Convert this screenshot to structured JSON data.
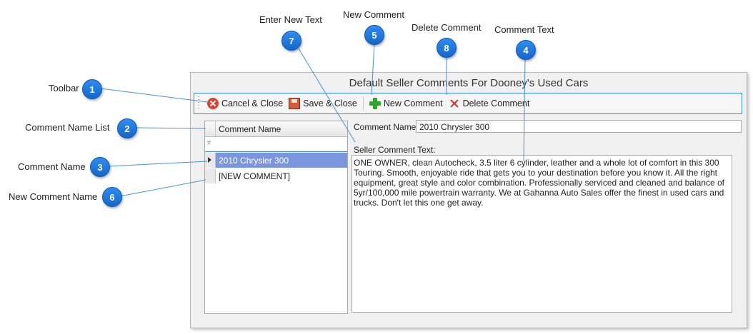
{
  "window": {
    "title": "Default Seller Comments For Dooney's Used Cars"
  },
  "toolbar": {
    "cancel_label": "Cancel & Close",
    "save_label": "Save & Close",
    "new_label": "New Comment",
    "delete_label": "Delete Comment"
  },
  "list": {
    "header": "Comment Name",
    "items": [
      {
        "label": "2010 Chrysler 300",
        "selected": true
      },
      {
        "label": "[NEW COMMENT]",
        "selected": false
      }
    ]
  },
  "form": {
    "name_label": "Comment Name:",
    "name_value": "2010 Chrysler 300",
    "text_label": "Seller Comment Text:",
    "text_value": "ONE OWNER, clean Autocheck, 3.5 liter 6 cylinder, leather and a whole lot of comfort in this 300 Touring. Smooth, enjoyable ride that gets you to your destination before you know it. All the right equipment, great style and color combination.  Professionally serviced and cleaned and balance of 5yr/100,000 mile powertrain warranty.  We at Gahanna Auto Sales offer the finest in used cars and trucks. Don't let this one get away."
  },
  "callouts": [
    {
      "num": "1",
      "label": "Toolbar"
    },
    {
      "num": "2",
      "label": "Comment Name List"
    },
    {
      "num": "3",
      "label": "Comment Name"
    },
    {
      "num": "4",
      "label": "Comment Text"
    },
    {
      "num": "5",
      "label": "New Comment"
    },
    {
      "num": "6",
      "label": "New Comment Name"
    },
    {
      "num": "7",
      "label": "Enter New Text"
    },
    {
      "num": "8",
      "label": "Delete Comment"
    }
  ],
  "colors": {
    "accent": "#3b8ad6",
    "badge": "#1e78e0",
    "selection": "#7b96dc"
  }
}
